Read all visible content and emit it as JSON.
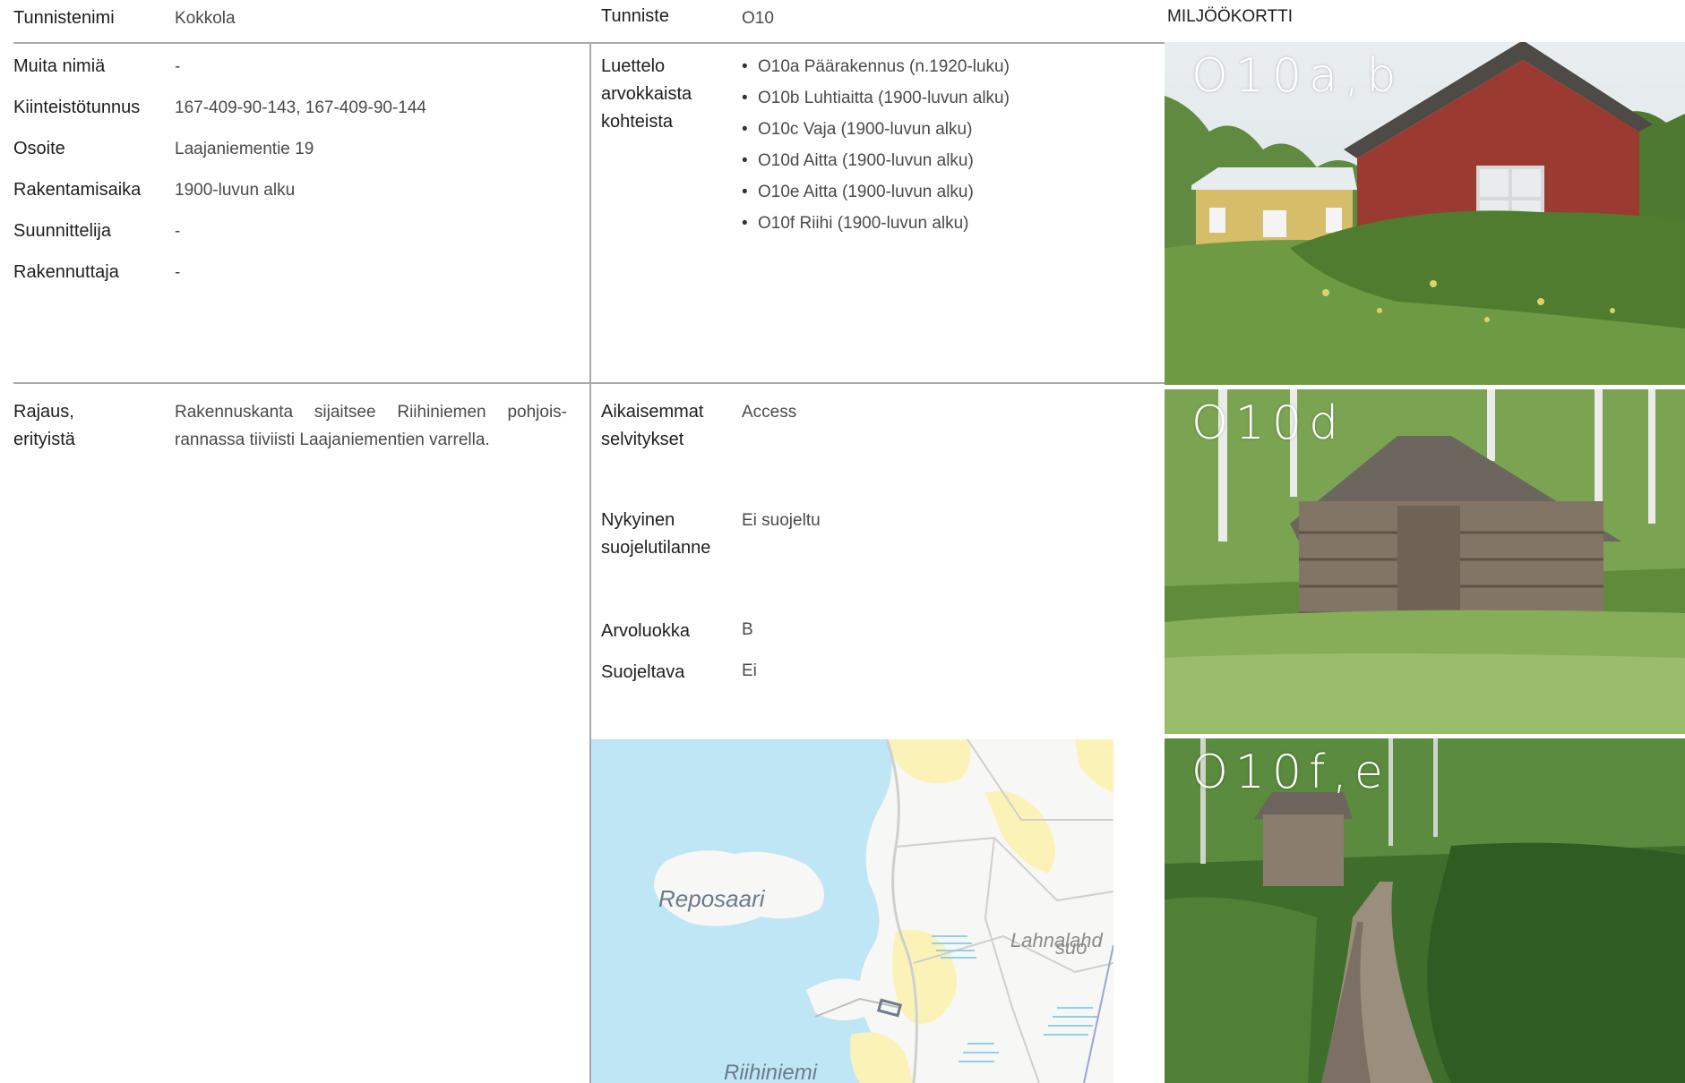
{
  "left_top": {
    "rows": [
      {
        "label": "Tunnistenimi",
        "value": "Kokkola"
      },
      {
        "label": "Muita nimiä",
        "value": "-"
      },
      {
        "label": "Kiinteistötunnus",
        "value": "167-409-90-143, 167-409-90-144"
      },
      {
        "label": "Osoite",
        "value": "Laajaniementie 19"
      },
      {
        "label": "Rakentamisaika",
        "value": "1900-luvun alku"
      },
      {
        "label": "Suunnittelija",
        "value": "-"
      },
      {
        "label": "Rakennuttaja",
        "value": "-"
      }
    ]
  },
  "mid_top": {
    "tunniste_label": "Tunniste",
    "tunniste_value": "O10",
    "list_label_lines": [
      "Luettelo",
      "arvokkaista",
      "kohteista"
    ],
    "items": [
      "O10a Päärakennus (n.1920-luku)",
      "O10b Luhtiaitta (1900-luvun alku)",
      "O10c Vaja (1900-luvun alku)",
      "O10d Aitta (1900-luvun alku)",
      "O10e Aitta (1900-luvun alku)",
      "O10f Riihi (1900-luvun alku)"
    ]
  },
  "left_bottom": {
    "label_lines": [
      "Rajaus,",
      "erityistä"
    ],
    "text_lines": [
      "Rakennuskanta sijaitsee Riihiniemen pohjois-",
      "rannassa tiiviisti Laajaniementien varrella."
    ]
  },
  "mid_bottom": {
    "aikaisemmat_label": [
      "Aikaisemmat",
      "selvitykset"
    ],
    "aikaisemmat_value": "Access",
    "nykyinen_label": [
      "Nykyinen",
      "suojelutilanne"
    ],
    "nykyinen_value": "Ei suojeltu",
    "arvoluokka_label": "Arvoluokka",
    "arvoluokka_value": "B",
    "suojeltava_label": "Suojeltava",
    "suojeltava_value": "Ei"
  },
  "map": {
    "labels": [
      "Reposaari",
      "Lahnalahd",
      "suo",
      "Riihiniemi"
    ],
    "colors": {
      "water": "#bfe6f4",
      "land": "#f7f7f5",
      "fields": "#fbf2b8",
      "roads": "#d0d0d0"
    }
  },
  "photos": {
    "header": "MILJÖÖKORTTI",
    "labels": [
      "O10a,b",
      "O10d",
      "O10f,e"
    ]
  },
  "colors": {
    "rule": "#a9a9a9",
    "text": "#1e1e1e",
    "value_text": "#4a4a4a"
  }
}
